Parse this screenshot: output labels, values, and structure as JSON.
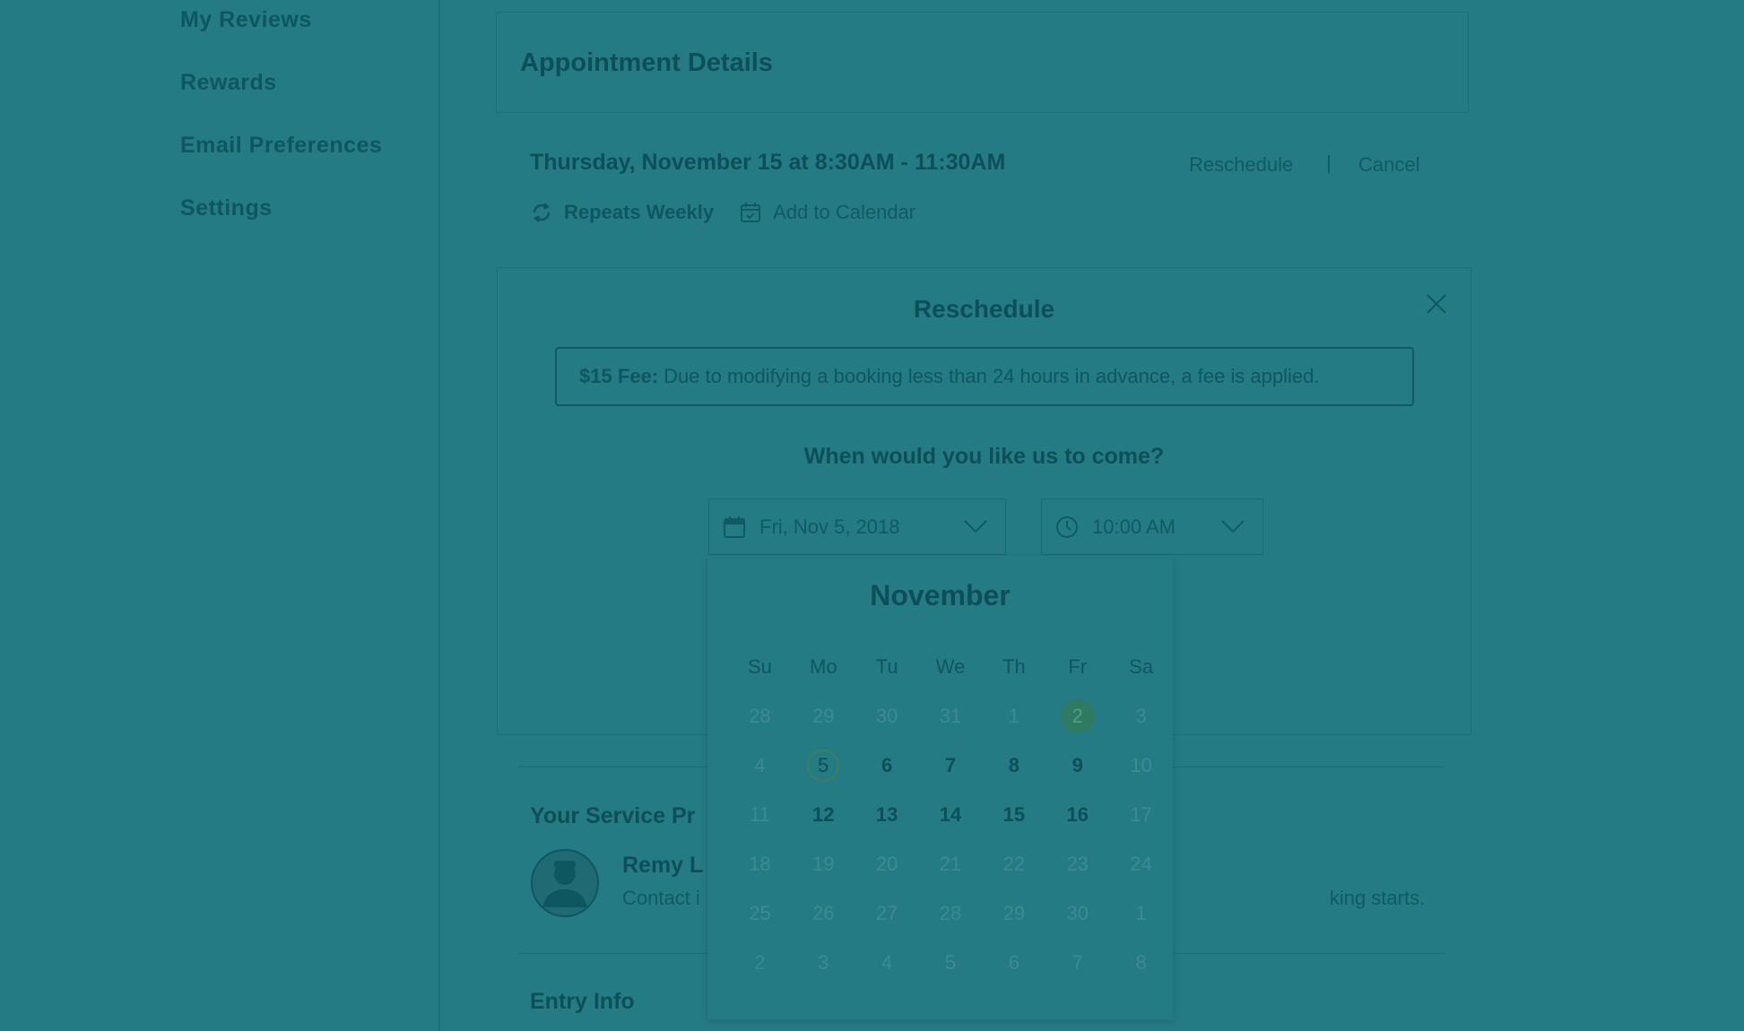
{
  "sidebar": {
    "items": [
      "My Reviews",
      "Rewards",
      "Email Preferences",
      "Settings"
    ]
  },
  "panel": {
    "title": "Appointment Details"
  },
  "appointment": {
    "datetime": "Thursday, November 15 at 8:30AM - 11:30AM",
    "reschedule_label": "Reschedule",
    "separator": "|",
    "cancel_label": "Cancel",
    "repeats": "Repeats Weekly",
    "add_calendar": "Add to Calendar"
  },
  "reschedule": {
    "title": "Reschedule",
    "fee_label": "$15 Fee:",
    "fee_text": "Due to modifying a booking less than 24 hours in advance, a fee is applied.",
    "question": "When would you like us to come?",
    "date_value": "Fri, Nov 5, 2018",
    "time_value": "10:00 AM"
  },
  "calendar": {
    "month": "November",
    "weekdays": [
      "Su",
      "Mo",
      "Tu",
      "We",
      "Th",
      "Fr",
      "Sa"
    ],
    "weeks": [
      [
        {
          "d": "28",
          "s": "muted"
        },
        {
          "d": "29",
          "s": "muted"
        },
        {
          "d": "30",
          "s": "muted"
        },
        {
          "d": "31",
          "s": "muted"
        },
        {
          "d": "1",
          "s": "muted"
        },
        {
          "d": "2",
          "s": "today"
        },
        {
          "d": "3",
          "s": "muted"
        }
      ],
      [
        {
          "d": "4",
          "s": "muted"
        },
        {
          "d": "5",
          "s": "selected"
        },
        {
          "d": "6",
          "s": "active"
        },
        {
          "d": "7",
          "s": "active"
        },
        {
          "d": "8",
          "s": "active"
        },
        {
          "d": "9",
          "s": "active"
        },
        {
          "d": "10",
          "s": "muted"
        }
      ],
      [
        {
          "d": "11",
          "s": "muted"
        },
        {
          "d": "12",
          "s": "active"
        },
        {
          "d": "13",
          "s": "active"
        },
        {
          "d": "14",
          "s": "active"
        },
        {
          "d": "15",
          "s": "active"
        },
        {
          "d": "16",
          "s": "active"
        },
        {
          "d": "17",
          "s": "muted"
        }
      ],
      [
        {
          "d": "18",
          "s": "muted"
        },
        {
          "d": "19",
          "s": "muted"
        },
        {
          "d": "20",
          "s": "muted"
        },
        {
          "d": "21",
          "s": "muted"
        },
        {
          "d": "22",
          "s": "muted"
        },
        {
          "d": "23",
          "s": "muted"
        },
        {
          "d": "24",
          "s": "muted"
        }
      ],
      [
        {
          "d": "25",
          "s": "muted"
        },
        {
          "d": "26",
          "s": "muted"
        },
        {
          "d": "27",
          "s": "muted"
        },
        {
          "d": "28",
          "s": "muted"
        },
        {
          "d": "29",
          "s": "muted"
        },
        {
          "d": "30",
          "s": "muted"
        },
        {
          "d": "1",
          "s": "muted"
        }
      ],
      [
        {
          "d": "2",
          "s": "muted"
        },
        {
          "d": "3",
          "s": "muted"
        },
        {
          "d": "4",
          "s": "muted"
        },
        {
          "d": "5",
          "s": "muted"
        },
        {
          "d": "6",
          "s": "muted"
        },
        {
          "d": "7",
          "s": "muted"
        },
        {
          "d": "8",
          "s": "muted"
        }
      ]
    ]
  },
  "provider": {
    "title": "Your Service Pr",
    "name": "Remy L",
    "contact_prefix": "Contact i",
    "contact_suffix": "king starts."
  },
  "entry": {
    "title": "Entry Info"
  },
  "colors": {
    "overlay_bg": "#257b84",
    "text_dark": "#0d4f58",
    "today_fill": "#2e7a63"
  },
  "icons": [
    "repeat-icon",
    "calendar-add-icon",
    "close-icon",
    "calendar-icon",
    "clock-icon",
    "chevron-down-icon",
    "avatar-icon"
  ]
}
